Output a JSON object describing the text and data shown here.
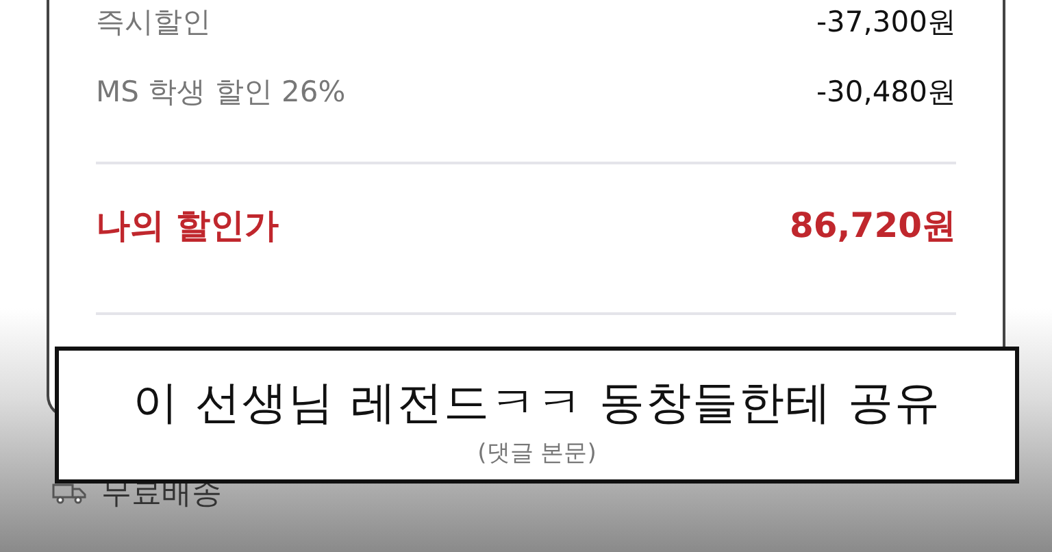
{
  "discounts": [
    {
      "label": "즉시할인",
      "amount": "-37,300원"
    },
    {
      "label": "MS 학생 할인 26%",
      "amount": "-30,480원"
    }
  ],
  "total": {
    "label": "나의 할인가",
    "amount": "86,720원"
  },
  "shipping": {
    "label": "무료배송"
  },
  "caption": {
    "text": "이 선생님 레전드ㅋㅋ 동창들한테 공유",
    "subtext": "(댓글 본문)"
  }
}
